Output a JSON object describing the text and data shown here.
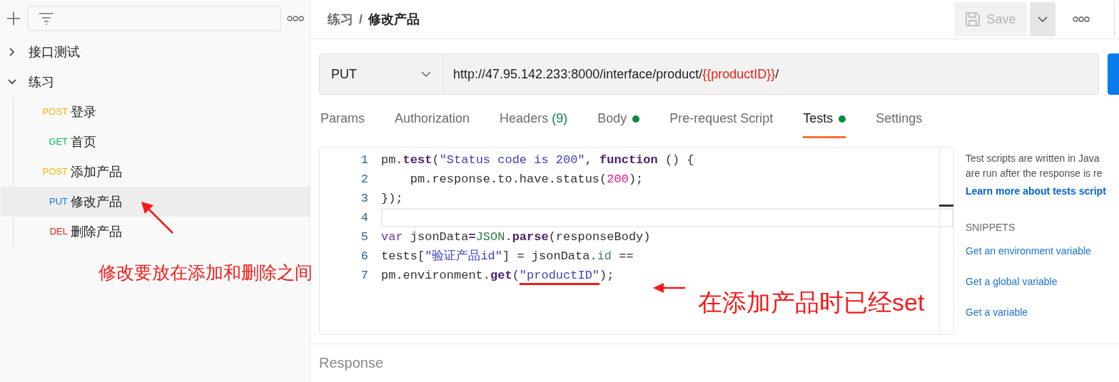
{
  "sidebar": {
    "items": [
      {
        "label": "接口测试",
        "expanded": false
      },
      {
        "label": "练习",
        "expanded": true,
        "children": [
          {
            "method": "POST",
            "color": "#ffb400",
            "label": "登录",
            "selected": false
          },
          {
            "method": "GET",
            "color": "#0cbb52",
            "label": "首页",
            "selected": false
          },
          {
            "method": "POST",
            "color": "#ffb400",
            "label": "添加产品",
            "selected": false
          },
          {
            "method": "PUT",
            "color": "#097bed",
            "label": "修改产品",
            "selected": true
          },
          {
            "method": "DEL",
            "color": "#eb2013",
            "label": "删除产品",
            "selected": false
          }
        ]
      }
    ]
  },
  "breadcrumb": [
    "练习",
    "修改产品"
  ],
  "breadcrumb_separator": "/",
  "save": {
    "label": "Save",
    "disabled": true
  },
  "request": {
    "method": "PUT",
    "url": "http://47.95.142.233:8000/interface/product/",
    "variable": "{{productID}}",
    "url_end": "/"
  },
  "tabs": [
    {
      "label": "Params",
      "selected": false
    },
    {
      "label": "Authorization",
      "selected": false
    },
    {
      "label": "Headers",
      "count": "(9)",
      "selected": false
    },
    {
      "label": "Body",
      "dot": true,
      "selected": false
    },
    {
      "label": "Pre-request Script",
      "selected": false
    },
    {
      "label": "Tests",
      "dot": true,
      "selected": true
    },
    {
      "label": "Settings",
      "selected": false
    }
  ],
  "editor": {
    "lines": [
      {
        "number": "1",
        "tokens": [
          {
            "text": "pm.",
            "kind": "plain"
          },
          {
            "text": "test",
            "kind": "call"
          },
          {
            "text": "(",
            "kind": "plain"
          },
          {
            "text": "\"Status code is 200\"",
            "kind": "string"
          },
          {
            "text": ", ",
            "kind": "plain"
          },
          {
            "text": "function",
            "kind": "keyword"
          },
          {
            "text": " () {",
            "kind": "plain"
          }
        ]
      },
      {
        "number": "2",
        "tokens": [
          {
            "text": "    pm.response.to.have.status(",
            "kind": "plain"
          },
          {
            "text": "200",
            "kind": "number"
          },
          {
            "text": ");",
            "kind": "plain"
          }
        ]
      },
      {
        "number": "3",
        "tokens": [
          {
            "text": "});",
            "kind": "plain"
          }
        ]
      },
      {
        "number": "4",
        "active": true
      },
      {
        "number": "5",
        "tokens": [
          {
            "text": "var",
            "kind": "var"
          },
          {
            "text": " jsonData",
            "kind": "plain"
          },
          {
            "text": "=",
            "kind": "call"
          },
          {
            "text": "JSON",
            "kind": "builtin"
          },
          {
            "text": ".",
            "kind": "plain"
          },
          {
            "text": "parse",
            "kind": "call"
          },
          {
            "text": "(responseBody)",
            "kind": "plain"
          }
        ]
      },
      {
        "number": "6",
        "tokens": [
          {
            "text": "tests[",
            "kind": "plain"
          },
          {
            "text": "\"验证产品id\"",
            "kind": "string"
          },
          {
            "text": "] = jsonData.",
            "kind": "plain"
          },
          {
            "text": "id",
            "kind": "property"
          },
          {
            "text": " ==",
            "kind": "plain"
          }
        ]
      },
      {
        "number": "7",
        "tokens": [
          {
            "text": "pm.environment.",
            "kind": "plain"
          },
          {
            "text": "get",
            "kind": "call"
          },
          {
            "text": "(",
            "kind": "plain"
          },
          {
            "text": "\"productID\"",
            "kind": "string",
            "underlined": true
          },
          {
            "text": ");",
            "kind": "plain"
          }
        ]
      }
    ]
  },
  "help": {
    "text": "Test scripts are written in Java",
    "text2": "are run after the response is re",
    "link": "Learn more about tests script",
    "snippets_title": "SNIPPETS",
    "snippets": [
      "Get an environment variable",
      "Get a global variable",
      "Get a variable"
    ]
  },
  "response": {
    "label": "Response"
  },
  "annotations": [
    "修改要放在添加和删除之间",
    "在添加产品时已经set"
  ]
}
